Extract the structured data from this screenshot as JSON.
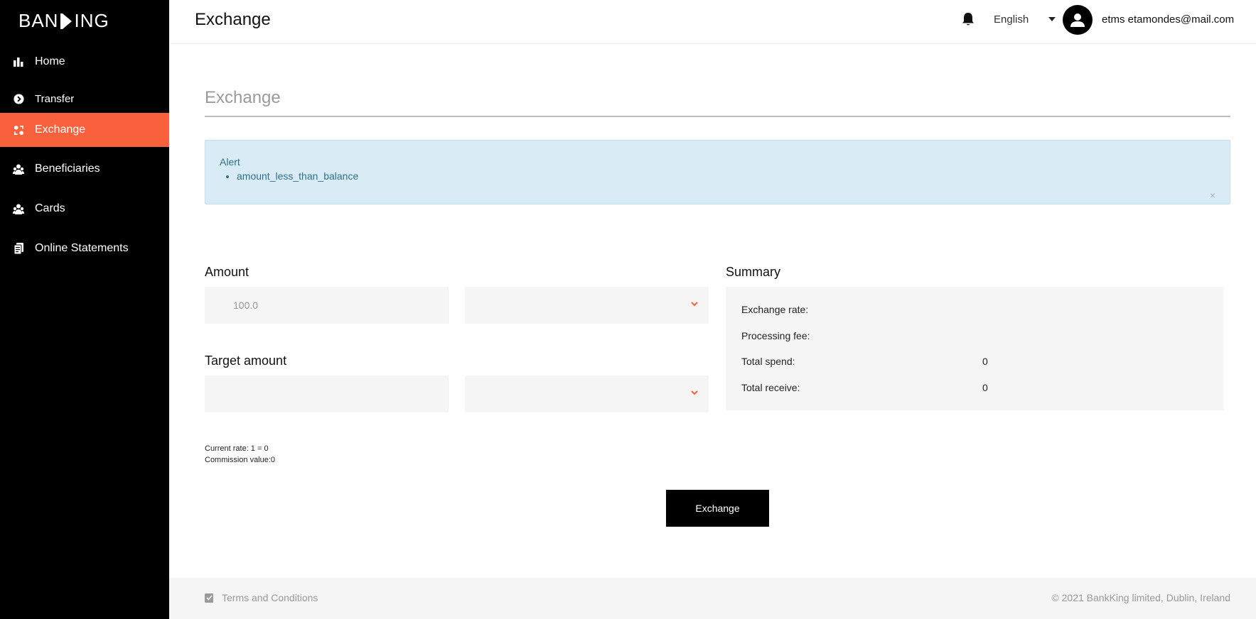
{
  "app": {
    "logo_prefix": "BAN",
    "logo_suffix": "ING"
  },
  "sidebar": {
    "items": [
      {
        "label": "Home",
        "icon": "bar-chart-icon"
      },
      {
        "label": "Transfer",
        "icon": "arrow-circle-icon"
      },
      {
        "label": "Exchange",
        "icon": "exchange-icon",
        "active": true
      },
      {
        "label": "Beneficiaries",
        "icon": "users-icon"
      },
      {
        "label": "Cards",
        "icon": "users-icon"
      },
      {
        "label": "Online Statements",
        "icon": "document-icon"
      }
    ]
  },
  "header": {
    "title": "Exchange",
    "language": "English",
    "user_name": "etms etamondes@mail.com"
  },
  "main": {
    "section_title": "Exchange",
    "alert": {
      "title": "Alert",
      "messages": [
        "amount_less_than_balance"
      ],
      "close": "×"
    },
    "amount_label": "Amount",
    "amount_value": "100.0",
    "target_label": "Target amount",
    "target_value": "",
    "summary": {
      "title": "Summary",
      "rows": [
        {
          "label": "Exchange rate:",
          "value": ""
        },
        {
          "label": "Processing fee:",
          "value": ""
        },
        {
          "label": "Total spend:",
          "value": "0"
        },
        {
          "label": "Total receive:",
          "value": "0"
        }
      ]
    },
    "current_rate": "Current rate: 1 = 0",
    "commission": "Commission value:0",
    "exchange_button": "Exchange"
  },
  "footer": {
    "terms": "Terms and Conditions",
    "copyright": "© 2021 BankKing limited, Dublin, Ireland"
  },
  "colors": {
    "accent": "#f9603c",
    "sidebar_bg": "#000000",
    "alert_bg": "#d9ecf5",
    "alert_text": "#31708f"
  }
}
